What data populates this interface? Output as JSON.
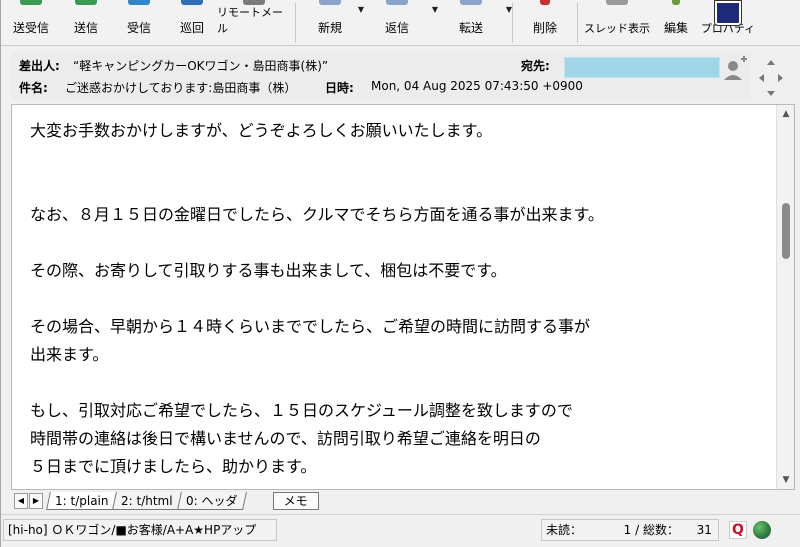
{
  "toolbar": {
    "buttons": [
      {
        "label": "送受信"
      },
      {
        "label": "送信"
      },
      {
        "label": "受信"
      },
      {
        "label": "巡回"
      },
      {
        "label": "リモートメール"
      },
      {
        "label": "新規"
      },
      {
        "label": "返信"
      },
      {
        "label": "転送"
      },
      {
        "label": "削除"
      },
      {
        "label": "スレッド表示"
      },
      {
        "label": "編集"
      },
      {
        "label": "プロパティ"
      }
    ]
  },
  "header": {
    "from_label": "差出人:",
    "from_value": "“軽キャンピングカーOKワゴン・島田商事(株)”",
    "to_label": "宛先:",
    "subject_label": "件名:",
    "subject_value": "ご迷惑おかけしております:島田商事（株）",
    "date_label": "日時:",
    "date_value": "Mon, 04 Aug 2025 07:43:50 +0900"
  },
  "body_lines": [
    "大変お手数おかけしますが、どうぞよろしくお願いいたします。",
    "",
    "",
    "なお、８月１５日の金曜日でしたら、クルマでそちら方面を通る事が出来ます。",
    "",
    "その際、お寄りして引取りする事も出来まして、梱包は不要です。",
    "",
    "その場合、早朝から１４時くらいまででしたら、ご希望の時間に訪問する事が",
    "出来ます。",
    "",
    "もし、引取対応ご希望でしたら、１５日のスケジュール調整を致しますので",
    "時間帯の連絡は後日で構いませんので、訪問引取り希望ご連絡を明日の",
    "５日までに頂けましたら、助かります。"
  ],
  "tabs": [
    {
      "label": "1: t/plain"
    },
    {
      "label": "2: t/html"
    },
    {
      "label": "0: ヘッダ"
    }
  ],
  "memo_label": "メモ",
  "status": {
    "folder": "[hi-ho] ＯＫワゴン/■お客様/A+A★HPアップ",
    "unread_label": "未読：",
    "position": "1",
    "total_label": "/ 総数：",
    "total": "31"
  },
  "colors": {
    "to_field": "#9fd6e8",
    "q_icon": "#c8102e",
    "globe_icon": "#2c7a3c"
  }
}
